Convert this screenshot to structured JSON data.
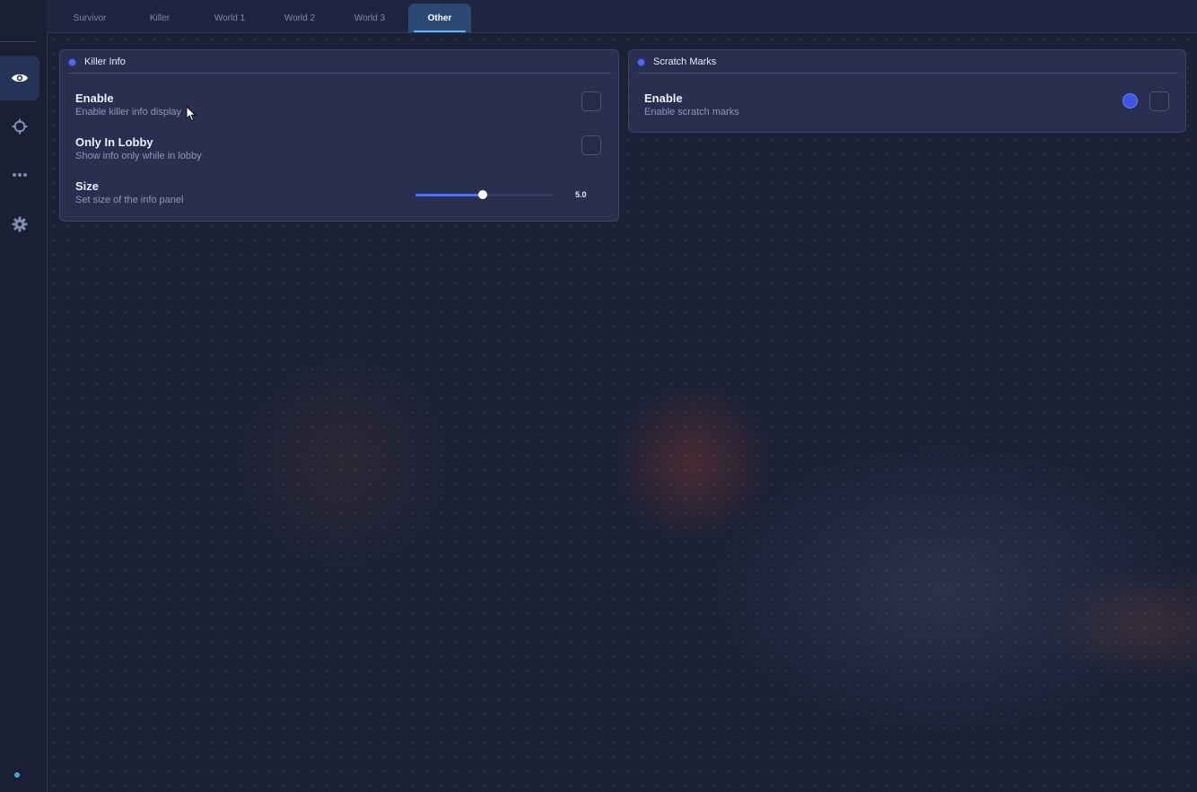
{
  "tabs": [
    {
      "label": "Survivor",
      "active": false
    },
    {
      "label": "Killer",
      "active": false
    },
    {
      "label": "World 1",
      "active": false
    },
    {
      "label": "World 2",
      "active": false
    },
    {
      "label": "World 3",
      "active": false
    },
    {
      "label": "Other",
      "active": true
    }
  ],
  "sidebar": {
    "items": [
      {
        "icon": "eye-icon",
        "active": true
      },
      {
        "icon": "crosshair-icon",
        "active": false
      },
      {
        "icon": "more-dots-icon",
        "active": false
      },
      {
        "icon": "gear-icon",
        "active": false
      }
    ]
  },
  "killer_info": {
    "title": "Killer Info",
    "enable": {
      "label": "Enable",
      "desc": "Enable killer info display",
      "checked": false
    },
    "only_in_lobby": {
      "label": "Only In Lobby",
      "desc": "Show info only while in lobby",
      "checked": false
    },
    "size": {
      "label": "Size",
      "desc": "Set size of the info panel",
      "value": "5.0",
      "fraction": 0.49
    }
  },
  "scratch_marks": {
    "title": "Scratch Marks",
    "enable": {
      "label": "Enable",
      "desc": "Enable scratch marks",
      "checked": false,
      "color": "#3b55e6"
    }
  },
  "colors": {
    "accent": "#4a72f5",
    "active_tab": "#2a4a74",
    "tab_underline": "#5db8ff"
  }
}
